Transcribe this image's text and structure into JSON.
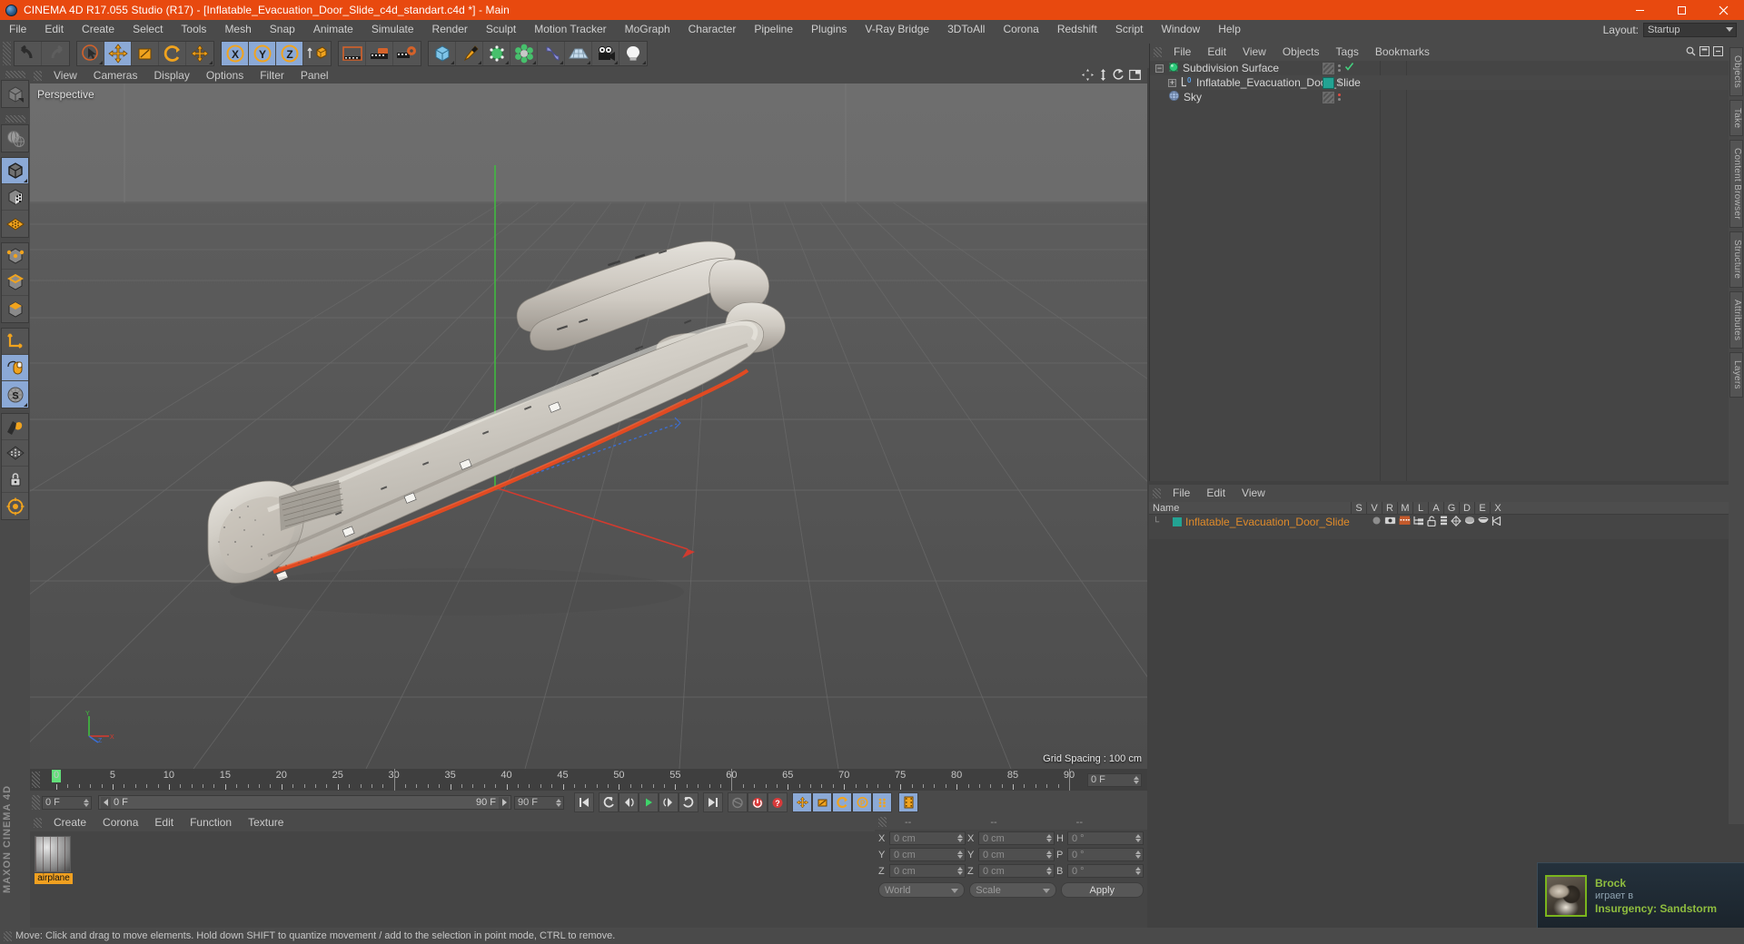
{
  "titlebar": {
    "title": "CINEMA 4D R17.055 Studio (R17) - [Inflatable_Evacuation_Door_Slide_c4d_standart.c4d *] - Main",
    "app_icon": "c4d-sphere-icon",
    "minimize": "minimize-icon",
    "maximize": "maximize-icon",
    "close": "close-icon",
    "accent_color": "#e8490f"
  },
  "menubar": {
    "items": [
      "File",
      "Edit",
      "Create",
      "Select",
      "Tools",
      "Mesh",
      "Snap",
      "Animate",
      "Simulate",
      "Render",
      "Sculpt",
      "Motion Tracker",
      "MoGraph",
      "Character",
      "Pipeline",
      "Plugins",
      "V-Ray Bridge",
      "3DToAll",
      "Corona",
      "Redshift",
      "Script",
      "Window",
      "Help"
    ],
    "layout_label": "Layout:",
    "layout_value": "Startup"
  },
  "toolbar": {
    "groups": [
      {
        "name": "history",
        "buttons": [
          {
            "name": "undo-icon",
            "active": false
          },
          {
            "name": "redo-icon",
            "active": false
          }
        ]
      },
      {
        "name": "transform",
        "buttons": [
          {
            "name": "live-selection-icon",
            "active": false
          },
          {
            "name": "move-tool-icon",
            "active": true
          },
          {
            "name": "scale-tool-icon",
            "active": false
          },
          {
            "name": "rotate-tool-icon",
            "active": false
          },
          {
            "name": "move-axis-icon",
            "active": false
          }
        ]
      },
      {
        "name": "axis-lock",
        "buttons": [
          {
            "name": "lock-x-axis-icon",
            "active": true
          },
          {
            "name": "lock-y-axis-icon",
            "active": true
          },
          {
            "name": "lock-z-axis-icon",
            "active": true
          },
          {
            "name": "world-object-coordinates-icon",
            "active": false
          }
        ]
      },
      {
        "name": "render",
        "buttons": [
          {
            "name": "render-view-icon",
            "active": false
          },
          {
            "name": "render-to-picture-viewer-icon",
            "active": false
          },
          {
            "name": "render-settings-icon",
            "active": false
          }
        ]
      },
      {
        "name": "create",
        "buttons": [
          {
            "name": "add-cube-primitive-icon",
            "active": false
          },
          {
            "name": "add-spline-pen-icon",
            "active": false
          },
          {
            "name": "add-generator-nurbs-icon",
            "active": false
          },
          {
            "name": "add-array-modeling-object-icon",
            "active": false
          },
          {
            "name": "add-deformer-icon",
            "active": false
          },
          {
            "name": "add-floor-scene-icon",
            "active": false
          },
          {
            "name": "add-camera-icon",
            "active": false
          },
          {
            "name": "add-light-icon",
            "active": false
          }
        ]
      }
    ]
  },
  "left_toolbar": {
    "buttons": [
      {
        "name": "make-editable-icon",
        "active": false
      },
      {
        "name": "viewport-solo-globe-icon",
        "active": false
      },
      {
        "name": "model-mode-icon",
        "active": true
      },
      {
        "name": "texture-mode-icon",
        "active": false
      },
      {
        "name": "workplane-mode-icon",
        "active": false
      },
      {
        "name": "point-mode-icon",
        "active": false
      },
      {
        "name": "edge-mode-icon",
        "active": false
      },
      {
        "name": "polygon-mode-icon",
        "active": false
      },
      {
        "name": "object-axis-mode-icon",
        "active": false
      },
      {
        "name": "enable-axis-modification-icon",
        "active": true
      },
      {
        "name": "snap-settings-icon",
        "active": true
      },
      {
        "name": "workplane-lock-icon",
        "active": false
      },
      {
        "name": "sculpt-brush-icon",
        "active": false
      },
      {
        "name": "grid-snap-icon",
        "active": false
      },
      {
        "name": "lock-workplane-icon",
        "active": false
      },
      {
        "name": "planar-workplane-icon",
        "active": false
      }
    ],
    "brand": "MAXON CINEMA 4D"
  },
  "viewport": {
    "menu": [
      "View",
      "Cameras",
      "Display",
      "Options",
      "Filter",
      "Panel"
    ],
    "label": "Perspective",
    "grid_spacing": "Grid Spacing : 100 cm",
    "header_icons": [
      "pan-view-icon",
      "zoom-view-icon",
      "rotate-view-icon",
      "toggle-layout-icon"
    ],
    "axis_gizmo": {
      "x": "X",
      "y": "Y",
      "z": "Z"
    }
  },
  "object_manager": {
    "menu": [
      "File",
      "Edit",
      "View",
      "Objects",
      "Tags",
      "Bookmarks"
    ],
    "header_icons": [
      "search-icon",
      "filter-icon",
      "collapse-icon"
    ],
    "rows": [
      {
        "name": "Subdivision Surface",
        "depth": 0,
        "icon": "subdivision-surface-icon",
        "expander": "-",
        "tag": "visible-check",
        "swatch": null
      },
      {
        "name": "Inflatable_Evacuation_Door_Slide",
        "depth": 1,
        "icon": "polygon-object-icon",
        "expander": "+",
        "tag": "material-tag",
        "swatch": "#23a393"
      },
      {
        "name": "Sky",
        "depth": 0,
        "icon": "sky-object-icon",
        "expander": null,
        "tag": "red-dot",
        "swatch": null
      }
    ]
  },
  "material_manager": {
    "menu": [
      "File",
      "Edit",
      "View"
    ],
    "columns": [
      "Name",
      "S",
      "V",
      "R",
      "M",
      "L",
      "A",
      "G",
      "D",
      "E",
      "X"
    ],
    "rows": [
      {
        "name": "Inflatable_Evacuation_Door_Slide",
        "swatch": "#23a393",
        "name_color": "#e08b2a",
        "icons": [
          "sphere-dot-icon",
          "display-tag-icon",
          "render-tag-icon",
          "hierarchy-icon",
          "unlock-icon",
          "layer-icon",
          "axis-icon",
          "disc-icon",
          "bowl-icon",
          "bend-icon"
        ]
      }
    ]
  },
  "edge_tabs": [
    "Objects",
    "Take",
    "Content Browser",
    "Structure",
    "Attributes",
    "Layers"
  ],
  "timeline": {
    "ticks": [
      0,
      5,
      10,
      15,
      20,
      25,
      30,
      35,
      40,
      45,
      50,
      55,
      60,
      65,
      70,
      75,
      80,
      85,
      90
    ],
    "current_frame": "0 F",
    "start_field": "0 F",
    "range_start": "0 F",
    "range_end": "90 F",
    "end_field": "90 F",
    "preview_end": "90 F",
    "playhead_frame": 0
  },
  "transport": {
    "buttons": [
      {
        "name": "go-to-start-icon",
        "active": false
      },
      {
        "name": "go-to-previous-key-icon",
        "active": false
      },
      {
        "name": "step-back-icon",
        "active": false
      },
      {
        "name": "play-forward-icon",
        "active": false
      },
      {
        "name": "step-forward-icon",
        "active": false
      },
      {
        "name": "go-to-next-key-icon",
        "active": false
      },
      {
        "name": "go-to-end-icon",
        "active": false
      },
      {
        "name": "autokeying-icon",
        "active": false
      },
      {
        "name": "record-active-objects-icon",
        "active": false
      },
      {
        "name": "keyframe-selection-icon",
        "active": false
      },
      {
        "name": "position-key-icon",
        "active": true
      },
      {
        "name": "scale-key-icon",
        "active": true
      },
      {
        "name": "rotation-key-icon",
        "active": true
      },
      {
        "name": "parameter-key-icon",
        "active": true
      },
      {
        "name": "point-level-animation-icon",
        "active": true
      },
      {
        "name": "timeline-toggle-icon",
        "active": true
      }
    ]
  },
  "material_panel": {
    "menu": [
      "Create",
      "Corona",
      "Edit",
      "Function",
      "Texture"
    ],
    "materials": [
      {
        "name": "airplane",
        "thumb": "sphere-preview",
        "selected": true
      }
    ]
  },
  "coordinates": {
    "headers": [
      "--",
      "--",
      "--"
    ],
    "rows": [
      {
        "label_pos": "X",
        "value_pos": "0 cm",
        "label_size": "X",
        "value_size": "0 cm",
        "label_rot": "H",
        "value_rot": "0 °"
      },
      {
        "label_pos": "Y",
        "value_pos": "0 cm",
        "label_size": "Y",
        "value_size": "0 cm",
        "label_rot": "P",
        "value_rot": "0 °"
      },
      {
        "label_pos": "Z",
        "value_pos": "0 cm",
        "label_size": "Z",
        "value_size": "0 cm",
        "label_rot": "B",
        "value_rot": "0 °"
      }
    ],
    "coord_system": "World",
    "mode": "Scale",
    "apply_label": "Apply"
  },
  "statusbar": {
    "text": "Move: Click and drag to move elements. Hold down SHIFT to quantize movement / add to the selection in point mode, CTRL to remove."
  },
  "toast": {
    "name": "Brock",
    "subtitle": "играет в",
    "game": "Insurgency: Sandstorm",
    "accent": "#8fbd3f"
  }
}
